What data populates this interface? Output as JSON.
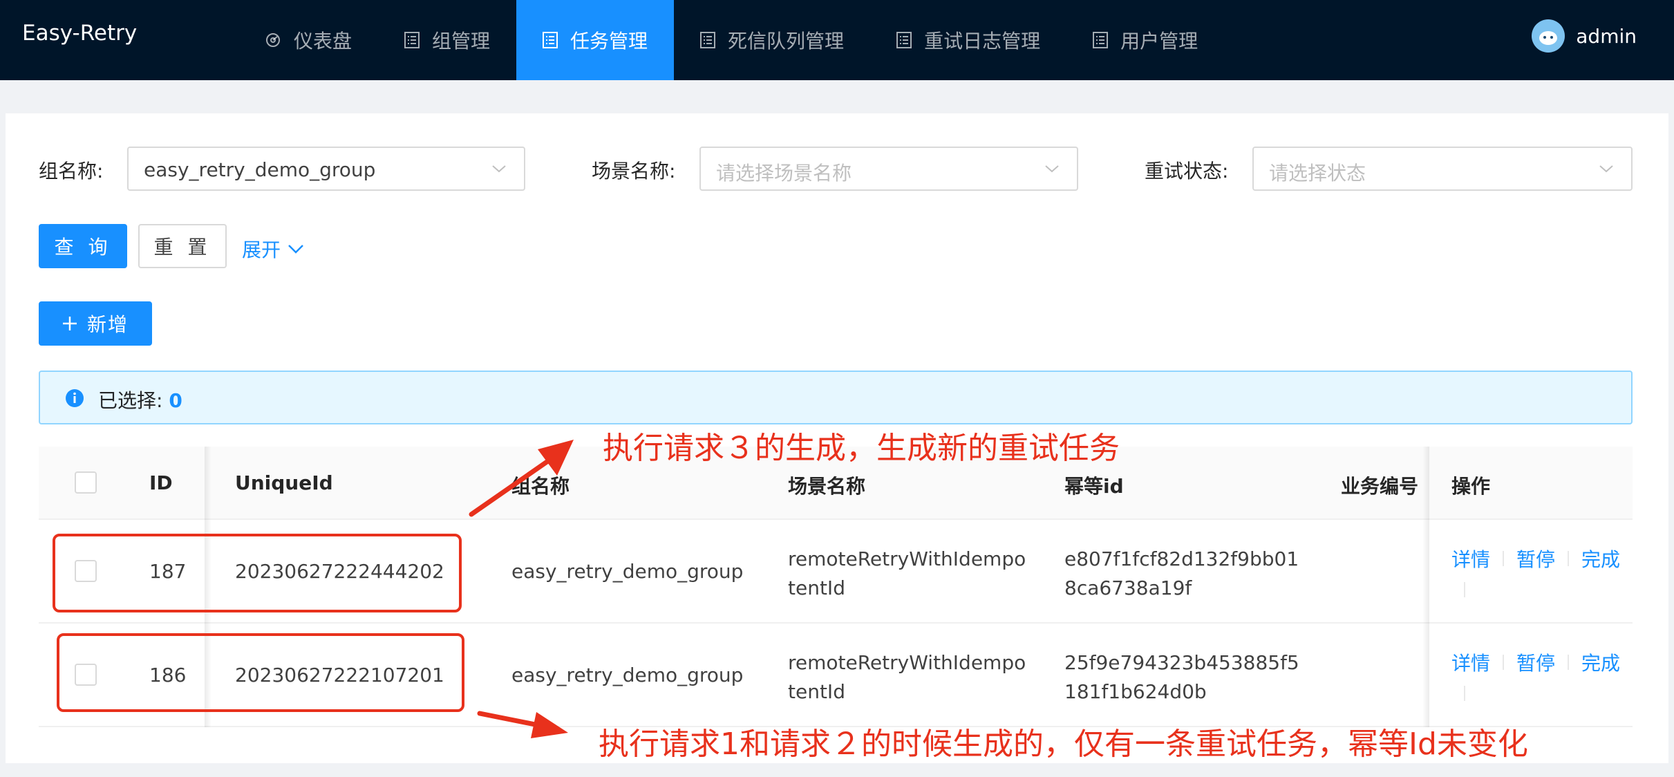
{
  "app": {
    "title": "Easy-Retry"
  },
  "nav": [
    {
      "label": "仪表盘",
      "icon": "dashboard-icon"
    },
    {
      "label": "组管理",
      "icon": "list-icon"
    },
    {
      "label": "任务管理",
      "icon": "list-icon",
      "active": true
    },
    {
      "label": "死信队列管理",
      "icon": "list-icon"
    },
    {
      "label": "重试日志管理",
      "icon": "list-icon"
    },
    {
      "label": "用户管理",
      "icon": "list-icon"
    }
  ],
  "user": {
    "name": "admin",
    "avatar_icon": "avatar-icon"
  },
  "filters": {
    "group": {
      "label": "组名称:",
      "value": "easy_retry_demo_group"
    },
    "scene": {
      "label": "场景名称:",
      "placeholder": "请选择场景名称"
    },
    "status": {
      "label": "重试状态:",
      "placeholder": "请选择状态"
    }
  },
  "buttons": {
    "query": "查 询",
    "reset": "重 置",
    "expand": "展开",
    "add": "新增"
  },
  "alert": {
    "label": "已选择:",
    "count": "0"
  },
  "table": {
    "headers": {
      "id": "ID",
      "unique_id": "UniqueId",
      "group": "组名称",
      "scene": "场景名称",
      "idempotent": "幂等id",
      "biz_no": "业务编号",
      "ops": "操作"
    },
    "rows": [
      {
        "id": "187",
        "unique_id": "20230627222444202",
        "group": "easy_retry_demo_group",
        "scene": "remoteRetryWithIdempotentId",
        "idempotent": "e807f1fcf82d132f9bb018ca6738a19f",
        "biz_no": ""
      },
      {
        "id": "186",
        "unique_id": "20230627222107201",
        "group": "easy_retry_demo_group",
        "scene": "remoteRetryWithIdempotentId",
        "idempotent": "25f9e794323b453885f5181f1b624d0b",
        "biz_no": ""
      }
    ],
    "actions": {
      "detail": "详情",
      "pause": "暂停",
      "finish": "完成"
    }
  },
  "annotations": {
    "top": "执行请求３的生成，生成新的重试任务",
    "bottom": "执行请求1和请求２的时候生成的，仅有一条重试任务，幂等Id未变化"
  },
  "colors": {
    "nav_bg": "#001529",
    "primary": "#1890ff",
    "annotation": "#e8311c",
    "alert_bg": "#e6f7ff"
  }
}
